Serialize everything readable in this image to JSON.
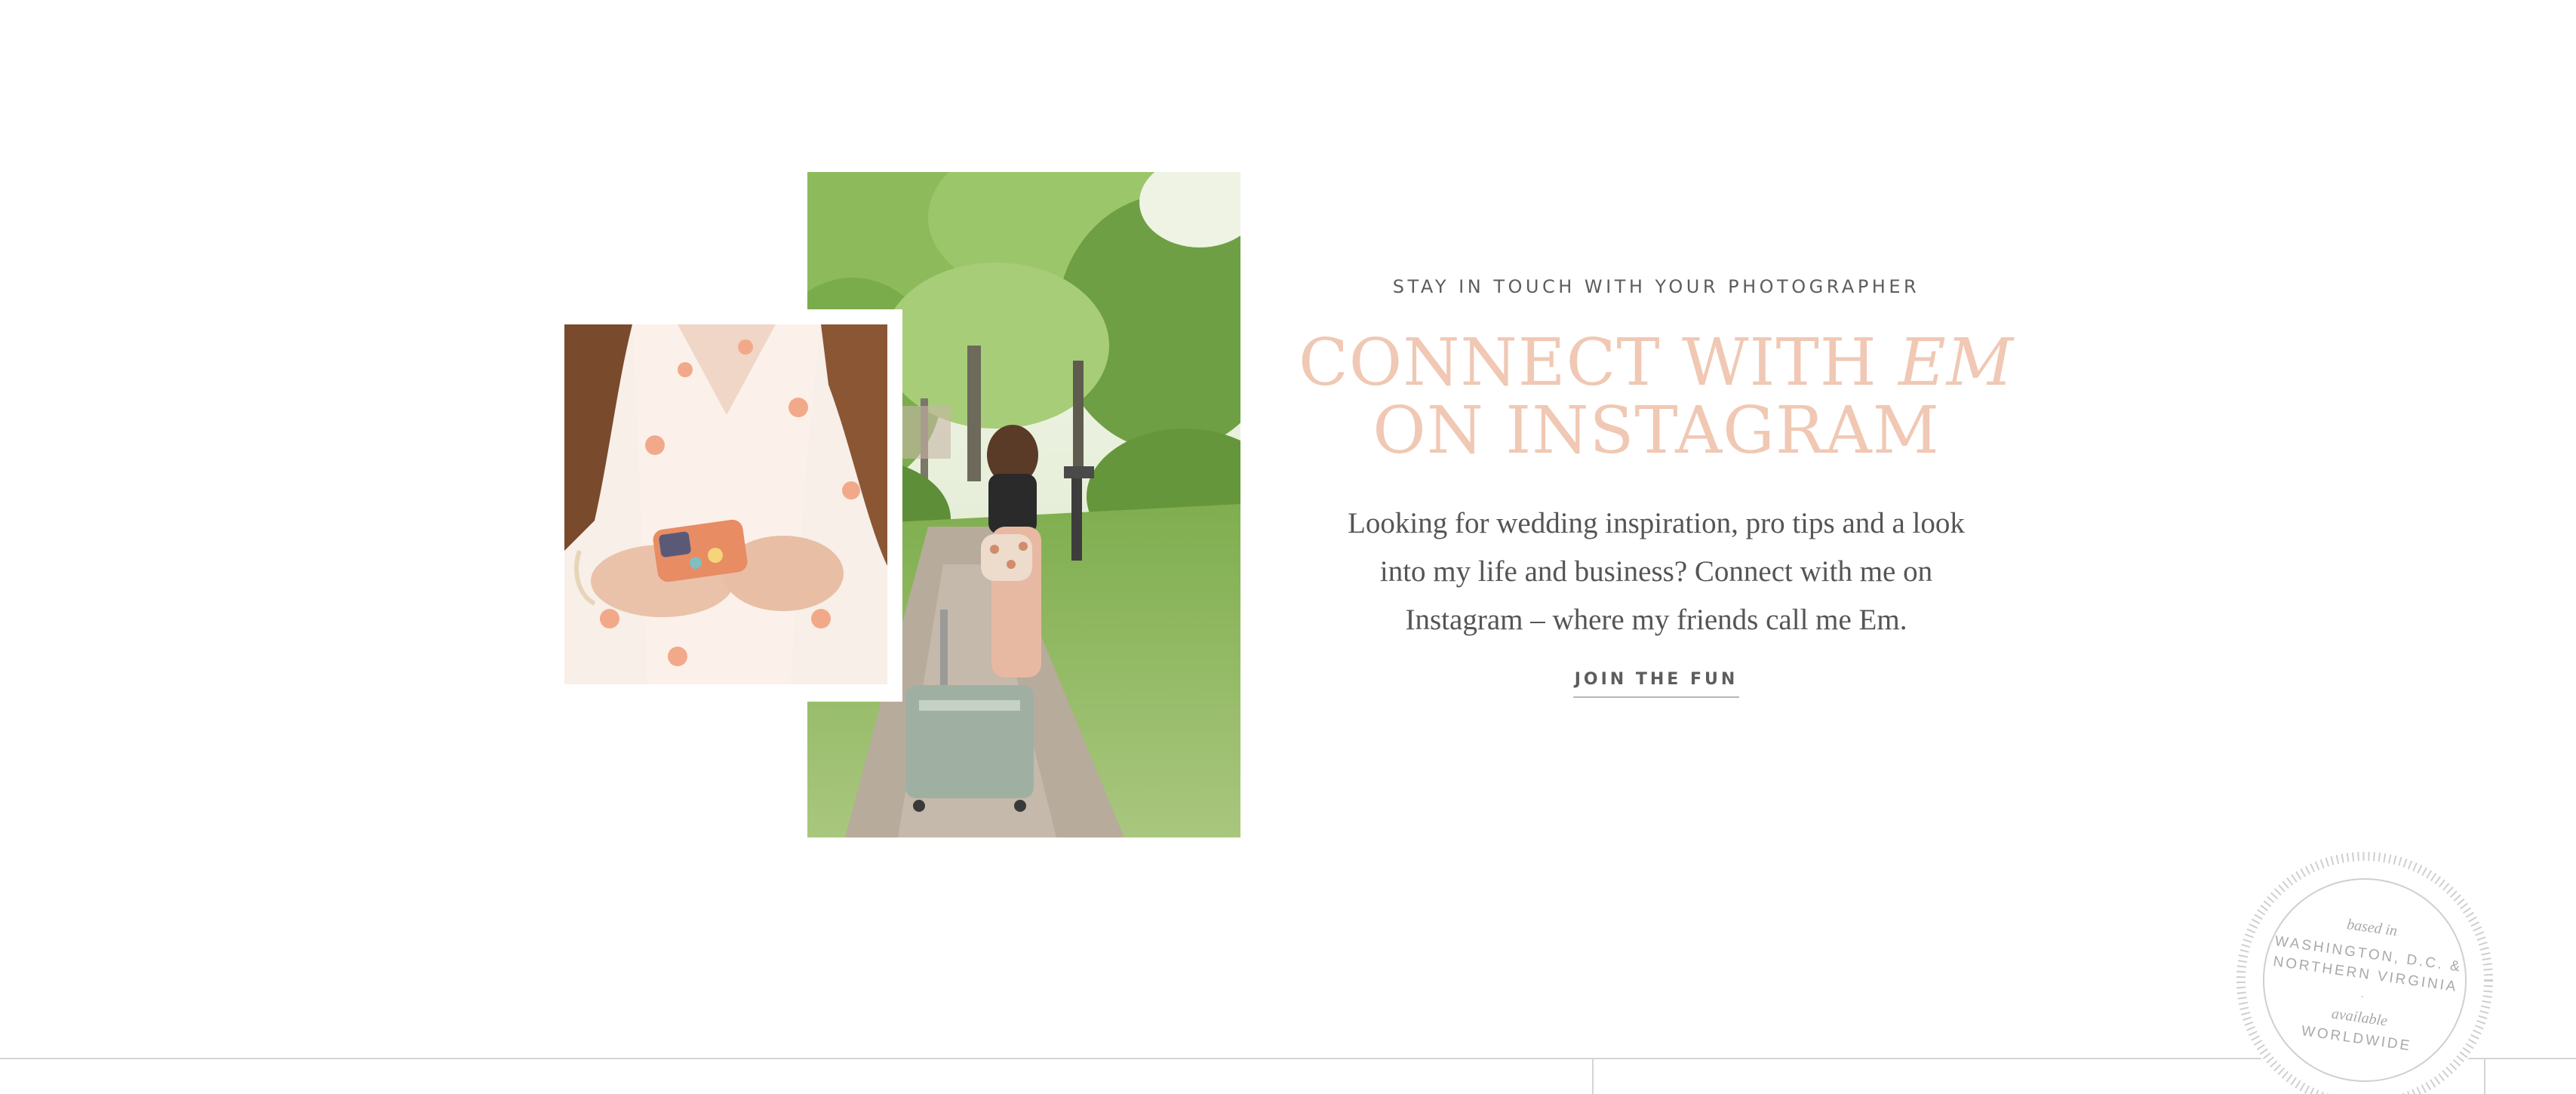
{
  "promo": {
    "eyebrow": "STAY IN TOUCH WITH YOUR PHOTOGRAPHER",
    "headline_line1_a": "CONNECT WITH ",
    "headline_line1_b": "EM",
    "headline_line2": "ON INSTAGRAM",
    "body": "Looking for wedding inspiration, pro tips and a look into my life and business? Connect with me on Instagram – where my friends call me Em.",
    "cta_label": "JOIN THE FUN"
  },
  "seal": {
    "line1": "based in",
    "line2": "WASHINGTON, D.C. &",
    "line3": "NORTHERN VIRGINIA",
    "line4": "available",
    "line5": "WORLDWIDE"
  },
  "colors": {
    "headline": "#f0c8b4",
    "text": "#5d5d5d",
    "rule": "#d4d4d4"
  }
}
